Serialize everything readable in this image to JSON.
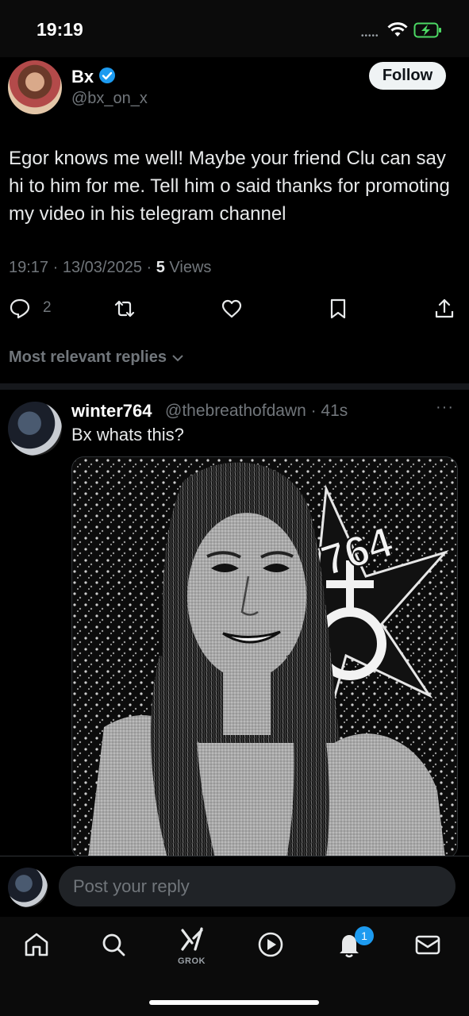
{
  "status_bar": {
    "time": "19:19",
    "signal": "•••••"
  },
  "post": {
    "author_name": "Bx",
    "author_handle": "@bx_on_x",
    "follow_label": "Follow",
    "text": "Egor knows me well! Maybe your friend Clu can say hi to him for me. Tell him o said thanks for promoting my video in his telegram channel",
    "time": "19:17",
    "date": "13/03/2025",
    "views_count": "5",
    "views_label": "Views",
    "reply_count": "2"
  },
  "replies_sort": {
    "label": "Most relevant replies"
  },
  "reply": {
    "author_name": "winter764",
    "author_handle": "@thebreathofdawn · 41s",
    "text": "Bx whats this?",
    "more": "···",
    "image_text": "764"
  },
  "compose": {
    "placeholder": "Post your reply"
  },
  "tabbar": {
    "grok_label": "GROK",
    "notifications_badge": "1"
  },
  "colors": {
    "accent": "#1d9bf0",
    "muted": "#71767b",
    "background": "#000000"
  },
  "icons": [
    "reply-icon",
    "repost-icon",
    "like-icon",
    "bookmark-icon",
    "share-icon",
    "home-icon",
    "search-icon",
    "grok-icon",
    "video-icon",
    "bell-icon",
    "mail-icon"
  ]
}
